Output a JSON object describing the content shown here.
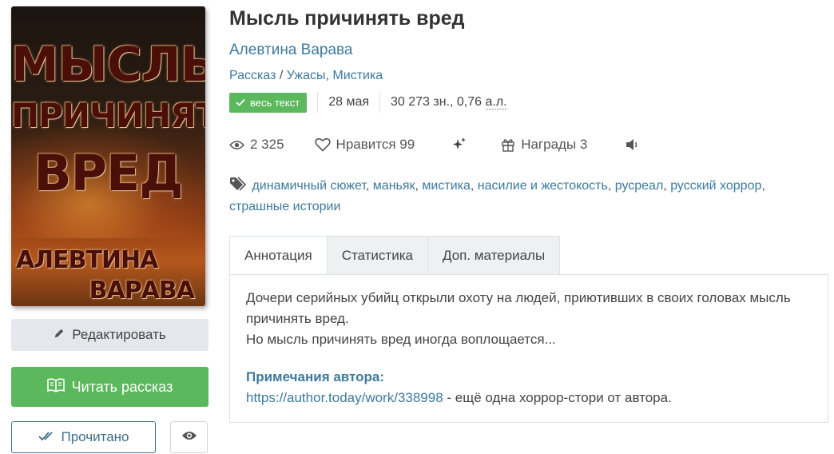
{
  "cover": {
    "title_line1": "МЫСЛЬ",
    "title_line2": "ПРИЧИНЯТЬ",
    "title_line3": "ВРЕД",
    "author_line1": "АЛЕВТИНА",
    "author_line2": "ВАРАВА"
  },
  "buttons": {
    "edit_label": "Редактировать",
    "read_label": "Читать рассказ",
    "done_label": "Прочитано"
  },
  "book": {
    "title": "Мысль причинять вред",
    "author": "Алевтина Варава",
    "form": "Рассказ",
    "genre_sep": " / ",
    "genre1": "Ужасы",
    "genre_comma": ", ",
    "genre2": "Мистика"
  },
  "info": {
    "badge": "весь текст",
    "date": "28 мая",
    "size": "30 273 зн., 0,76",
    "size_unit": "а.л."
  },
  "stats": {
    "views": "2 325",
    "likes": "Нравится 99",
    "awards": "Награды 3"
  },
  "tags": [
    "динамичный сюжет",
    "маньяк",
    "мистика",
    "насилие и жестокость",
    "русреал",
    "русский хоррор",
    "страшные истории"
  ],
  "tabs": [
    "Аннотация",
    "Статистика",
    "Доп. материалы"
  ],
  "annotation": {
    "line1": "Дочери серийных убийц открыли охоту на людей, приютивших в своих головах мысль причинять вред.",
    "line2": "Но мысль причинять вред иногда воплощается...",
    "notes_title": "Примечания автора:",
    "notes_link": "https://author.today/work/338998",
    "notes_text": " - ещё одна хоррор-стори от автора."
  },
  "colors": {
    "link": "#3d7a9c",
    "green": "#5cb85c",
    "title": "#333333"
  }
}
